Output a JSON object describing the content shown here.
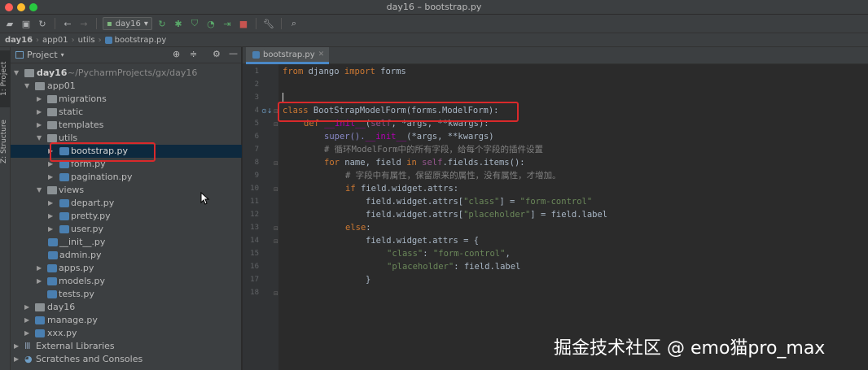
{
  "window": {
    "title": "day16 – bootstrap.py"
  },
  "toolbar": {
    "run_config": "day16"
  },
  "navbar": {
    "crumbs": [
      "day16",
      "app01",
      "utils",
      "bootstrap.py"
    ]
  },
  "side_tabs": {
    "project": "1: Project",
    "structure": "Z: Structure"
  },
  "project_panel": {
    "header": "Project",
    "root_name": "day16",
    "root_path": "~/PycharmProjects/gx/day16",
    "items": [
      {
        "label": "app01"
      },
      {
        "label": "migrations"
      },
      {
        "label": "static"
      },
      {
        "label": "templates"
      },
      {
        "label": "utils"
      },
      {
        "label": "bootstrap.py"
      },
      {
        "label": "form.py"
      },
      {
        "label": "pagination.py"
      },
      {
        "label": "views"
      },
      {
        "label": "depart.py"
      },
      {
        "label": "pretty.py"
      },
      {
        "label": "user.py"
      },
      {
        "label": "__init__.py"
      },
      {
        "label": "admin.py"
      },
      {
        "label": "apps.py"
      },
      {
        "label": "models.py"
      },
      {
        "label": "tests.py"
      },
      {
        "label": "day16"
      },
      {
        "label": "manage.py"
      },
      {
        "label": "xxx.py"
      },
      {
        "label": "External Libraries"
      },
      {
        "label": "Scratches and Consoles"
      }
    ]
  },
  "editor": {
    "tab": "bootstrap.py",
    "line_numbers": [
      "1",
      "2",
      "3",
      "4",
      "5",
      "6",
      "7",
      "8",
      "9",
      "10",
      "11",
      "12",
      "13",
      "14",
      "15",
      "16",
      "17",
      "18"
    ]
  },
  "code": {
    "l1": {
      "a": "from",
      "b": " django ",
      "c": "import",
      "d": " forms"
    },
    "l4": {
      "a": "class",
      "b": " BootStrapModelForm(forms.ModelForm):"
    },
    "l5": {
      "a": "def ",
      "b": "__init__",
      "c": "(",
      "d": "self",
      "e": ", *args, **kwargs):"
    },
    "l6": {
      "a": "super().",
      "b": "__init__",
      "c": "(*args, **kwargs)"
    },
    "l7": "# 循环ModelForm中的所有字段，给每个字段的插件设置",
    "l8": {
      "a": "for",
      "b": " name, field ",
      "c": "in",
      "d": " ",
      "e": "self",
      "f": ".fields.items():"
    },
    "l9": "# 字段中有属性，保留原来的属性，没有属性，才增加。",
    "l10": {
      "a": "if",
      "b": " field.widget.attrs:"
    },
    "l11": {
      "a": "field.widget.attrs[",
      "b": "\"class\"",
      "c": "] = ",
      "d": "\"form-control\""
    },
    "l12": {
      "a": "field.widget.attrs[",
      "b": "\"placeholder\"",
      "c": "] = field.label"
    },
    "l13": {
      "a": "else",
      "b": ":"
    },
    "l14": "field.widget.attrs = {",
    "l15": {
      "a": "\"class\"",
      "b": ": ",
      "c": "\"form-control\"",
      "d": ","
    },
    "l16": {
      "a": "\"placeholder\"",
      "b": ": field.label"
    },
    "l17": "}"
  },
  "watermark": "掘金技术社区 @ emo猫pro_max",
  "colors": {
    "accent": "#d9292b",
    "selection": "#0d293e",
    "keyword": "#cc7832",
    "string": "#6a8759"
  }
}
